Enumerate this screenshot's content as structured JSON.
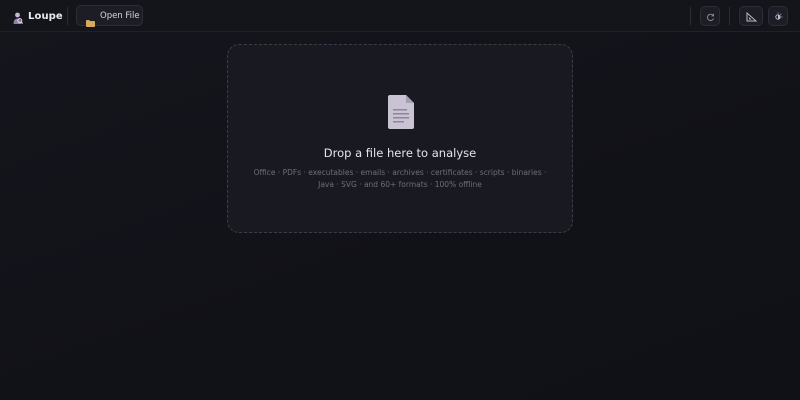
{
  "header": {
    "app_name": "Loupe",
    "open_file_label": "Open File",
    "logo_icon": "magnifier-person-icon",
    "folder_icon": "folder-icon",
    "buttons": {
      "refresh_icon": "refresh-icon",
      "layout_icon": "triangle-ruler-icon",
      "theme_icon": "theme-toggle-icon"
    }
  },
  "dropzone": {
    "icon": "document-icon",
    "title": "Drop a file here to analyse",
    "subtitle": "Office · PDFs · executables · emails · archives · certificates · scripts · binaries · Java · SVG · and 60+ formats · 100% offline"
  },
  "colors": {
    "background": "#121319",
    "topbar": "#14151b",
    "panel": "#191a21",
    "accent_doc": "#c9c3d3",
    "folder": "#d9a85a"
  }
}
